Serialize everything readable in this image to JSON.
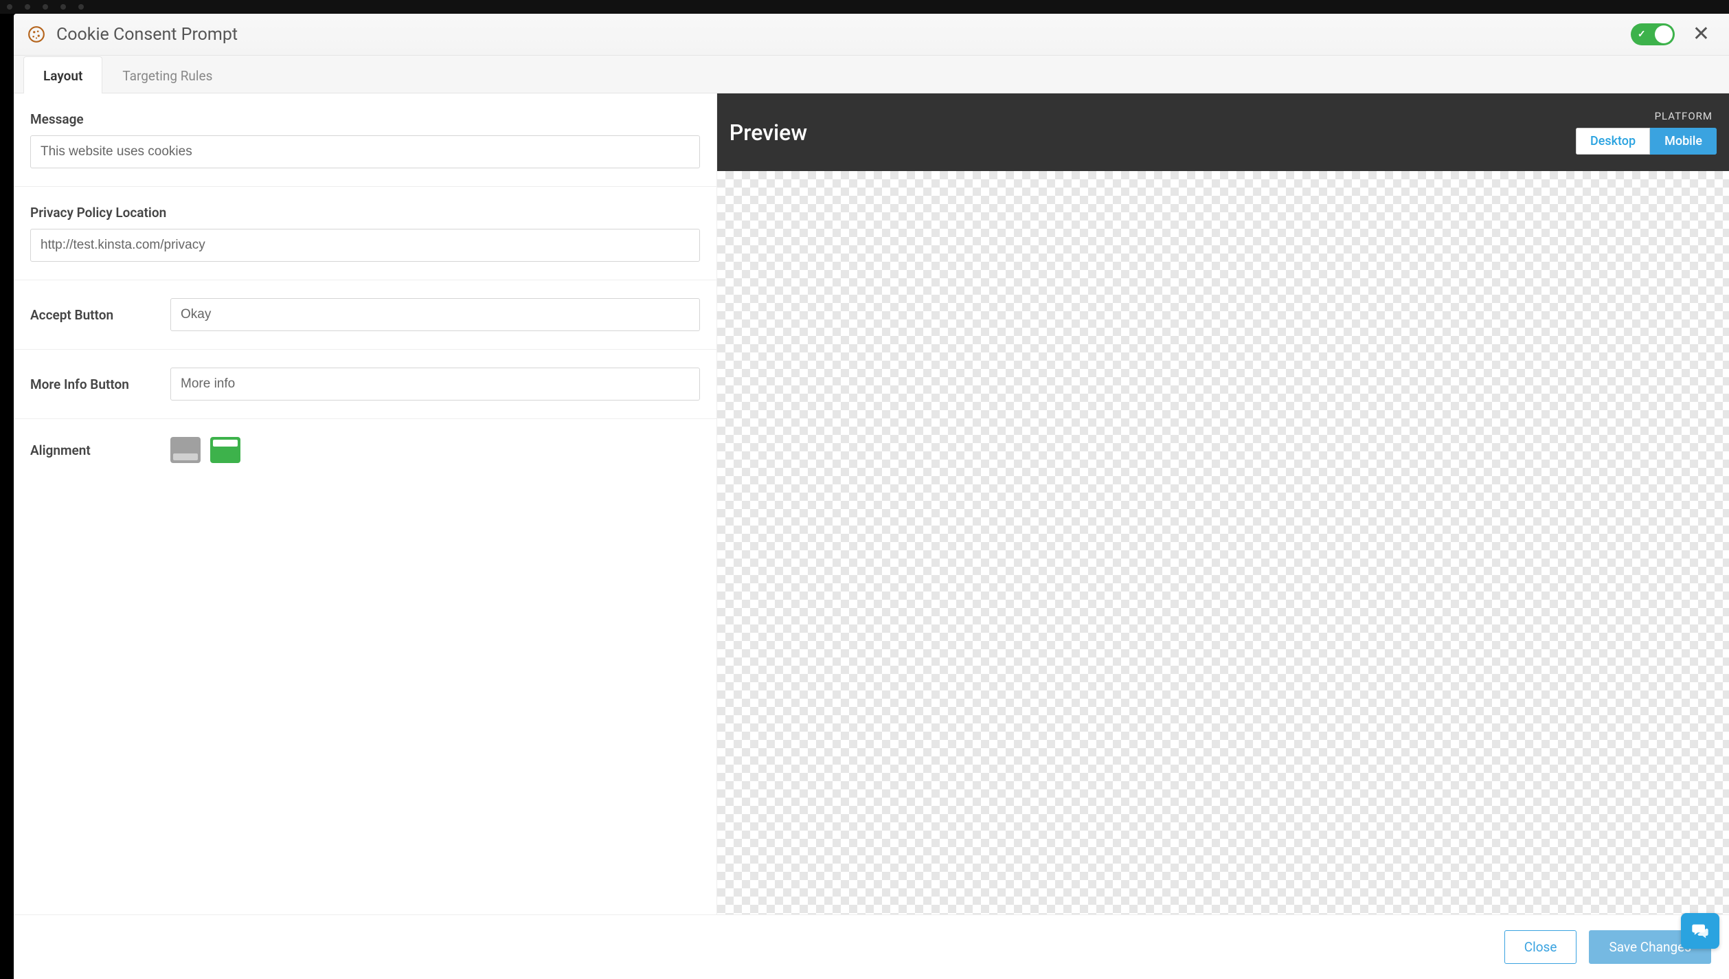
{
  "header": {
    "title": "Cookie Consent Prompt",
    "toggle_on": true
  },
  "tabs": {
    "layout": "Layout",
    "targeting": "Targeting Rules",
    "active": "layout"
  },
  "form": {
    "message_label": "Message",
    "message_value": "This website uses cookies",
    "privacy_label": "Privacy Policy Location",
    "privacy_value": "http://test.kinsta.com/privacy",
    "accept_label": "Accept Button",
    "accept_value": "Okay",
    "moreinfo_label": "More Info Button",
    "moreinfo_value": "More info",
    "alignment_label": "Alignment",
    "alignment_selected": "top"
  },
  "preview": {
    "title": "Preview",
    "platform_label": "PLATFORM",
    "btn_desktop": "Desktop",
    "btn_mobile": "Mobile",
    "active_platform": "Mobile"
  },
  "footer": {
    "close": "Close",
    "save": "Save Changes"
  }
}
